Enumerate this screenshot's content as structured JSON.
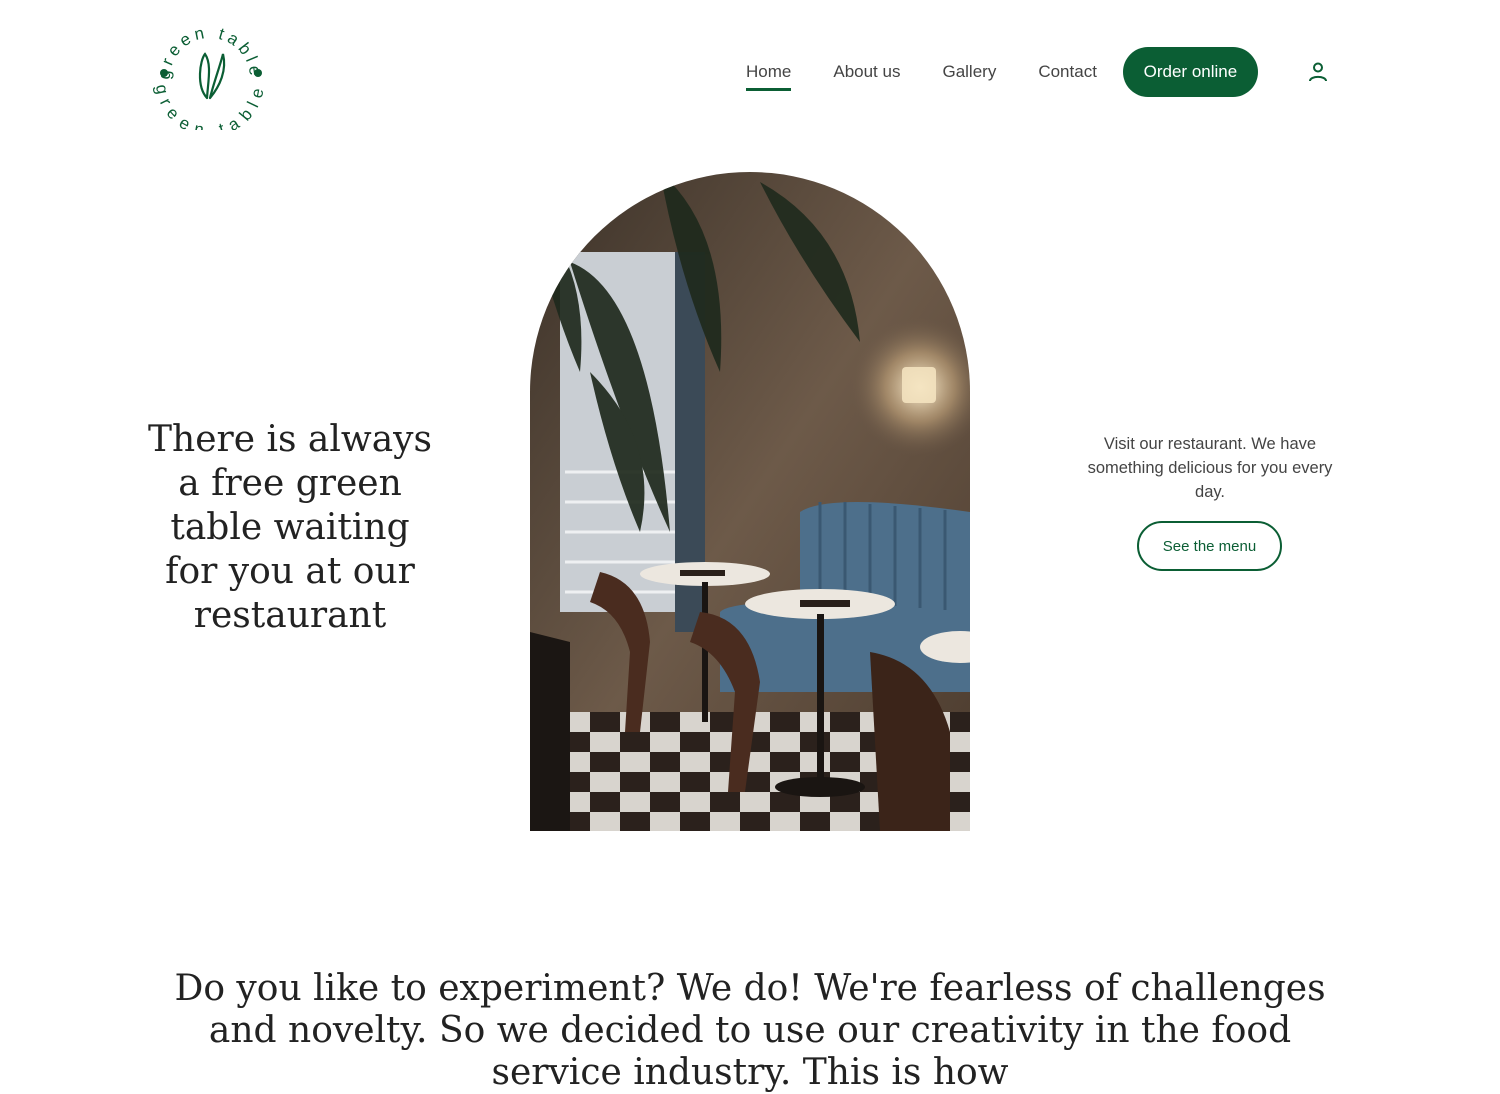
{
  "brand": {
    "logo_text": "green table",
    "accent_color": "#0b5e34"
  },
  "nav": {
    "items": [
      {
        "label": "Home",
        "active": true
      },
      {
        "label": "About us",
        "active": false
      },
      {
        "label": "Gallery",
        "active": false
      },
      {
        "label": "Contact",
        "active": false
      }
    ],
    "order_button": "Order online",
    "account_icon": "user-icon"
  },
  "hero": {
    "heading": "There is always a free green table waiting for you at our restaurant",
    "side_text": "Visit our restaurant. We have something delicious for you every day.",
    "menu_button": "See the menu",
    "image_icon": "restaurant-interior-photo"
  },
  "intro": {
    "text": "Do you like to experiment? We do! We're fearless of challenges and novelty. So we decided to use our creativity in the food service industry. This is how"
  }
}
